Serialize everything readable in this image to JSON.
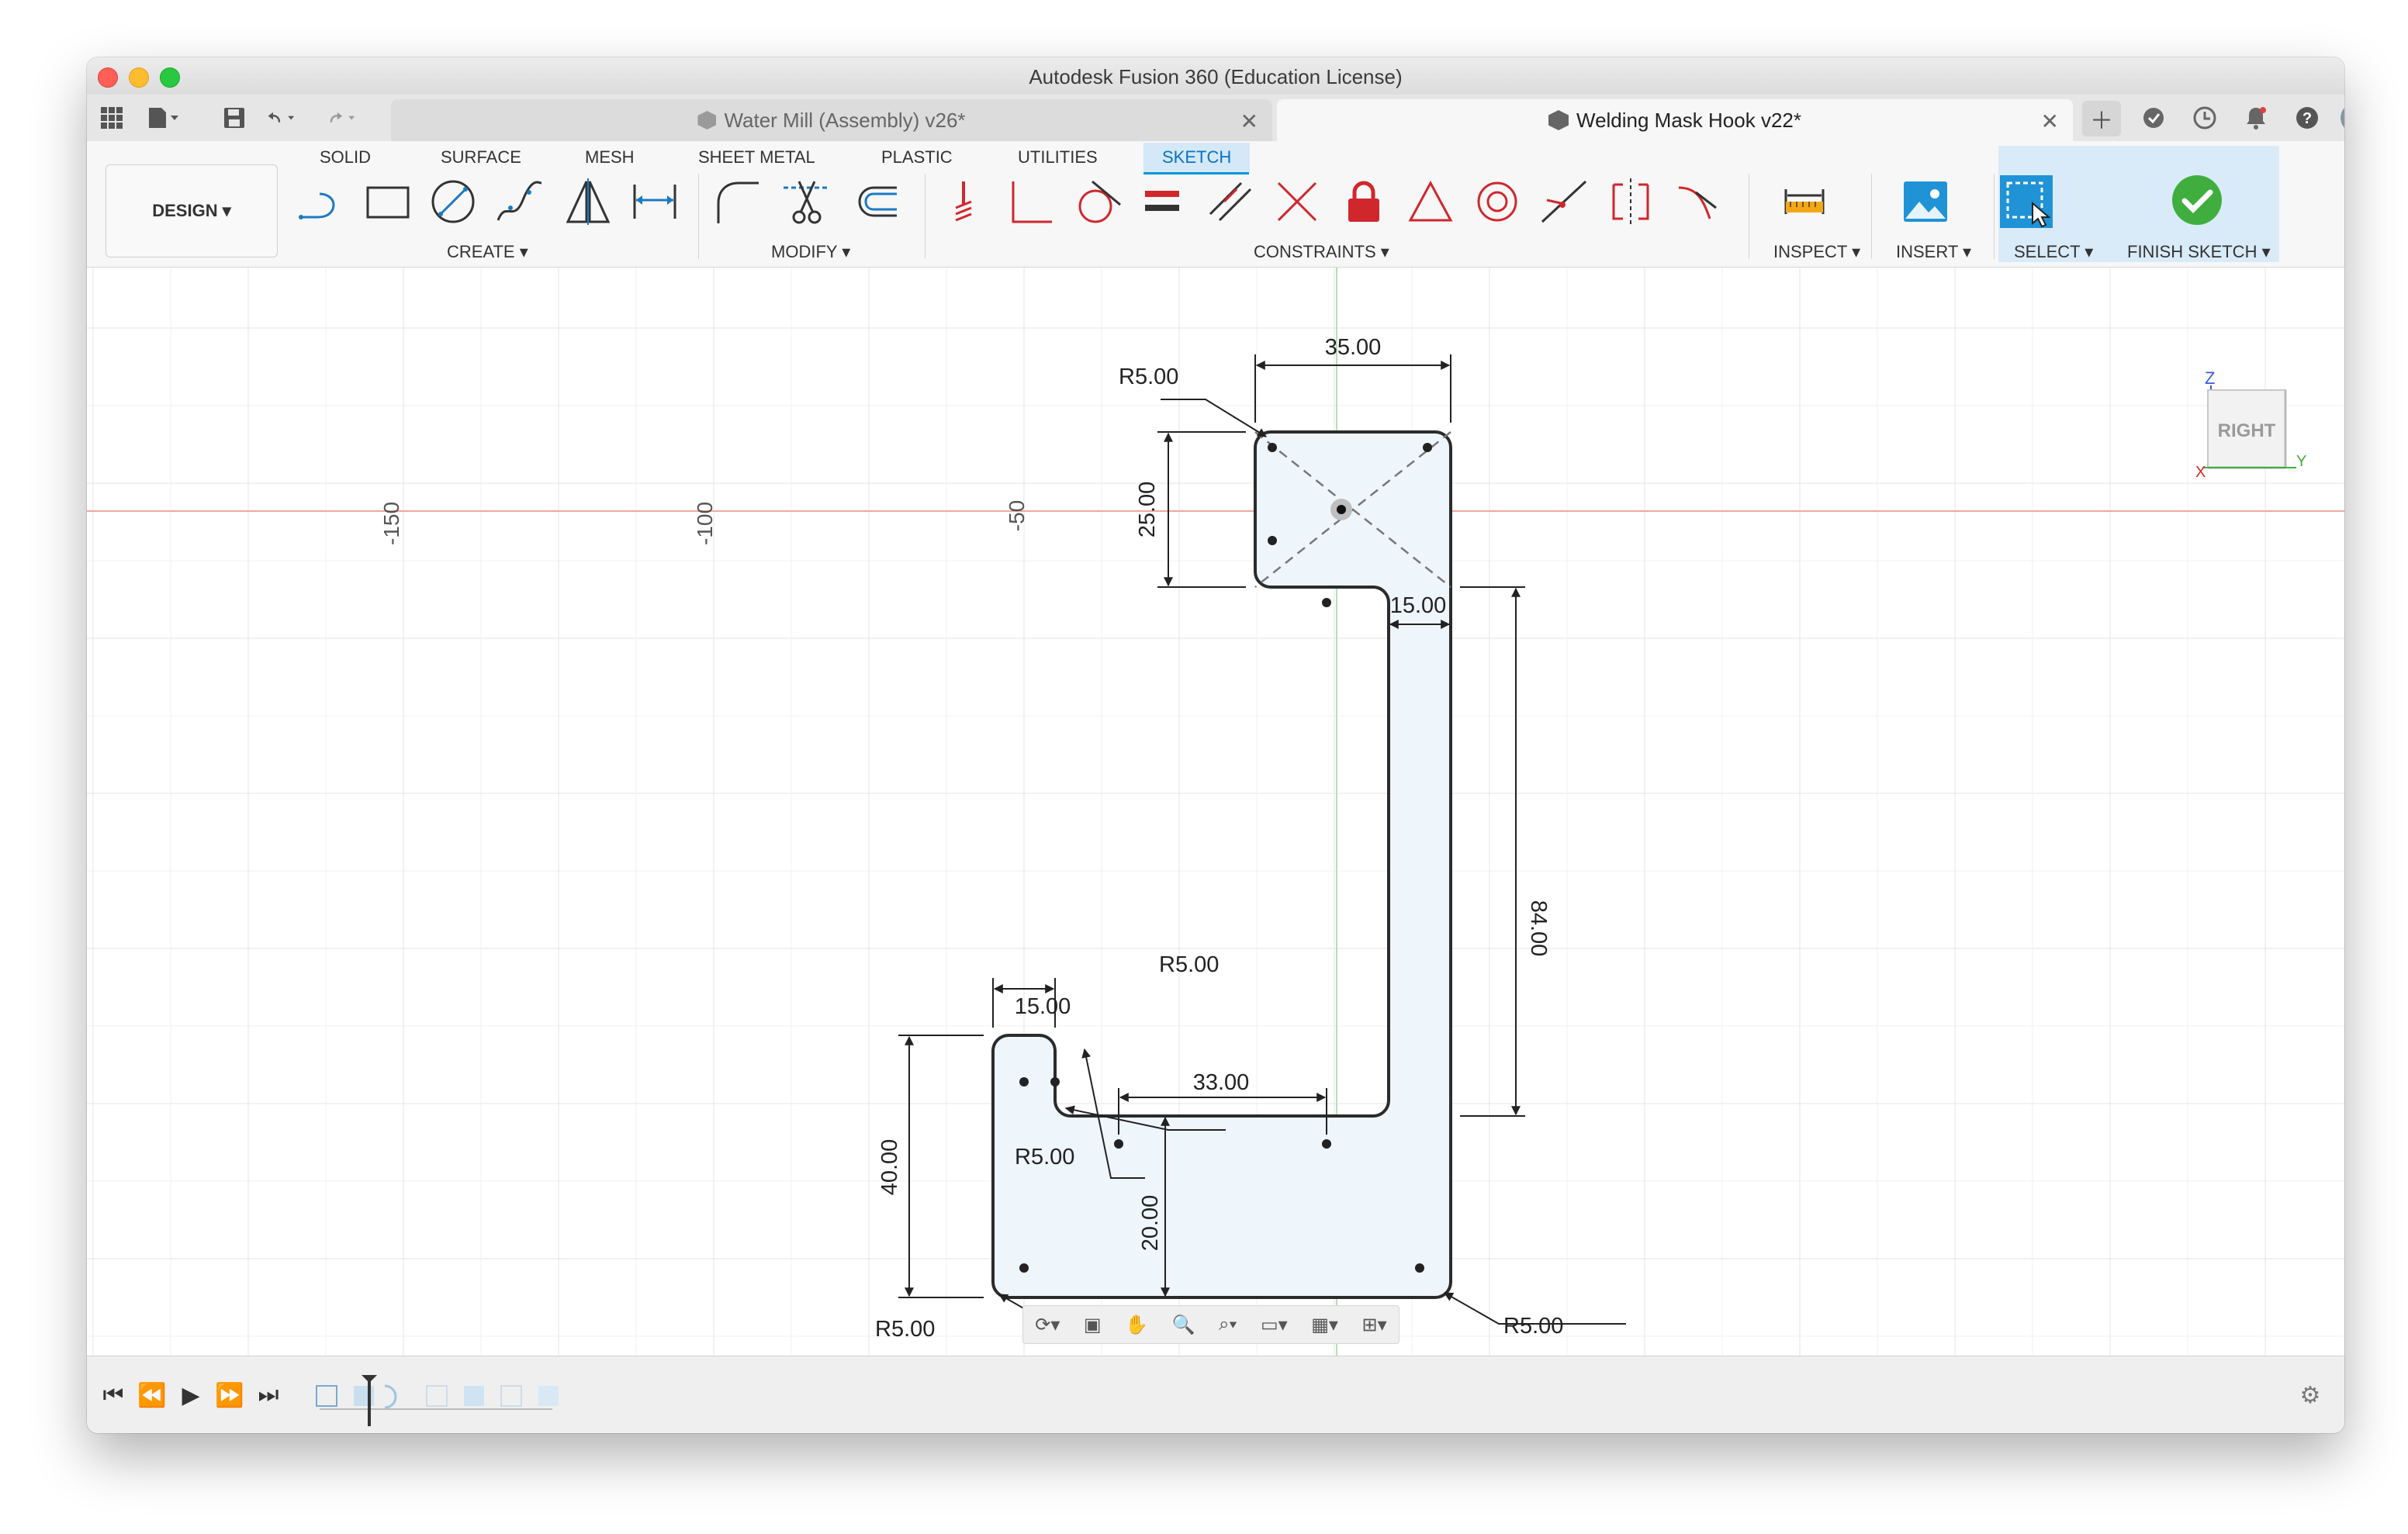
{
  "window": {
    "title": "Autodesk Fusion 360 (Education License)"
  },
  "tabs": [
    {
      "label": "Water Mill (Assembly) v26*",
      "active": false
    },
    {
      "label": "Welding Mask Hook v22*",
      "active": true
    }
  ],
  "ribbon": {
    "workspace": "DESIGN ▾",
    "tabs": [
      "SOLID",
      "SURFACE",
      "MESH",
      "SHEET METAL",
      "PLASTIC",
      "UTILITIES",
      "SKETCH"
    ],
    "active_tab": "SKETCH",
    "groups": {
      "create": "CREATE ▾",
      "modify": "MODIFY ▾",
      "constraints": "CONSTRAINTS ▾",
      "inspect": "INSPECT ▾",
      "insert": "INSERT ▾",
      "select": "SELECT ▾",
      "finish": "FINISH SKETCH ▾"
    }
  },
  "colors": {
    "accent": "#0696d7",
    "constraint_red": "#d0272d",
    "sketch_fill": "#eef5fb",
    "finish_green": "#3fae3f"
  },
  "canvas": {
    "axis_labels": [
      "-150",
      "-100",
      "-50"
    ],
    "dimensions": {
      "top_width": "35.00",
      "top_height": "25.00",
      "stem_width": "15.00",
      "stem_height": "84.00",
      "inner_width": "33.00",
      "lower_tab_width": "15.00",
      "lower_tab_height": "40.00",
      "bottom_height": "20.00",
      "r_top_left": "R5.00",
      "r_lower_tab": "R5.00",
      "r_inner": "R5.00",
      "r_bottom_left": "R5.00",
      "r_bottom_right": "R5.00"
    },
    "viewcube": {
      "face": "RIGHT",
      "axis_z": "Z",
      "axis_y": "Y",
      "axis_x": "X"
    }
  },
  "icons": {
    "titlebar": [
      "app-grid-icon",
      "file-icon",
      "save-icon",
      "undo-icon",
      "redo-icon"
    ],
    "tab_right": [
      "new-tab-icon",
      "extensions-icon",
      "job-status-icon",
      "notifications-icon",
      "help-icon",
      "profile-icon"
    ],
    "nav_bar": [
      "orbit-icon",
      "look-at-icon",
      "pan-icon",
      "zoom-icon",
      "zoom-window-icon",
      "display-settings-icon",
      "grid-settings-icon",
      "viewports-icon"
    ],
    "timeline": [
      "first-icon",
      "previous-icon",
      "play-icon",
      "next-icon",
      "last-icon",
      "settings-gear-icon"
    ]
  }
}
